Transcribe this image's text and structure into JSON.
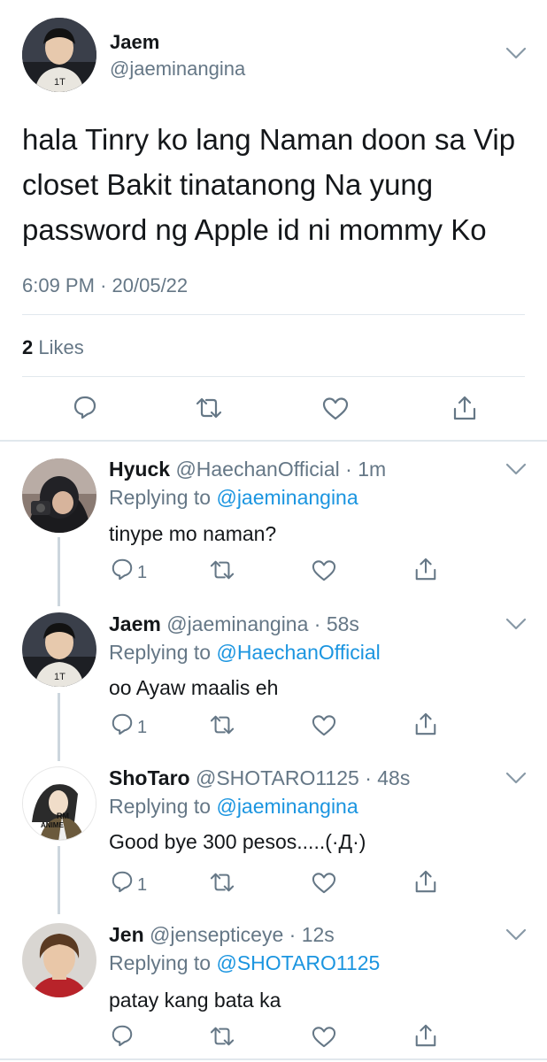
{
  "main_tweet": {
    "name": "Jaem",
    "handle": "@jaeminangina",
    "text_lines": [
      "hala Tinry ko lang Naman doon sa Vip",
      "closet Bakit tinatanong Na yung",
      "password ng Apple id ni mommy Ko"
    ],
    "time": "6:09 PM",
    "separator": "·",
    "date": "20/05/22",
    "likes_count": "2",
    "likes_label": "Likes",
    "avatar_icon": "avatar-photo"
  },
  "replies": [
    {
      "name": "Hyuck",
      "handle": "@HaechanOfficial",
      "time": "1m",
      "replying_label": "Replying to",
      "replying_to": "@jaeminangina",
      "text": "tinype mo naman?",
      "reply_count": "1"
    },
    {
      "name": "Jaem",
      "handle": "@jaeminangina",
      "time": "58s",
      "replying_label": "Replying to",
      "replying_to": "@HaechanOfficial",
      "text": "oo Ayaw maalis eh",
      "reply_count": "1"
    },
    {
      "name": "ShoTaro",
      "handle": "@SHOTARO1125",
      "time": "48s",
      "replying_label": "Replying to",
      "replying_to": "@jaeminangina",
      "text": "Good bye 300 pesos.....(·Д·)",
      "reply_count": "1",
      "avatar_text_1": "RM",
      "avatar_text_2": "ANIME"
    },
    {
      "name": "Jen",
      "handle": "@jensepticeye",
      "time": "12s",
      "replying_label": "Replying to",
      "replying_to": "@SHOTARO1125",
      "text": "patay kang bata ka",
      "reply_count": ""
    }
  ],
  "colors": {
    "text": "#14171a",
    "secondary": "#657786",
    "link": "#1b95e0",
    "divider": "#e1e8ed",
    "thread": "#ccd6dd"
  }
}
